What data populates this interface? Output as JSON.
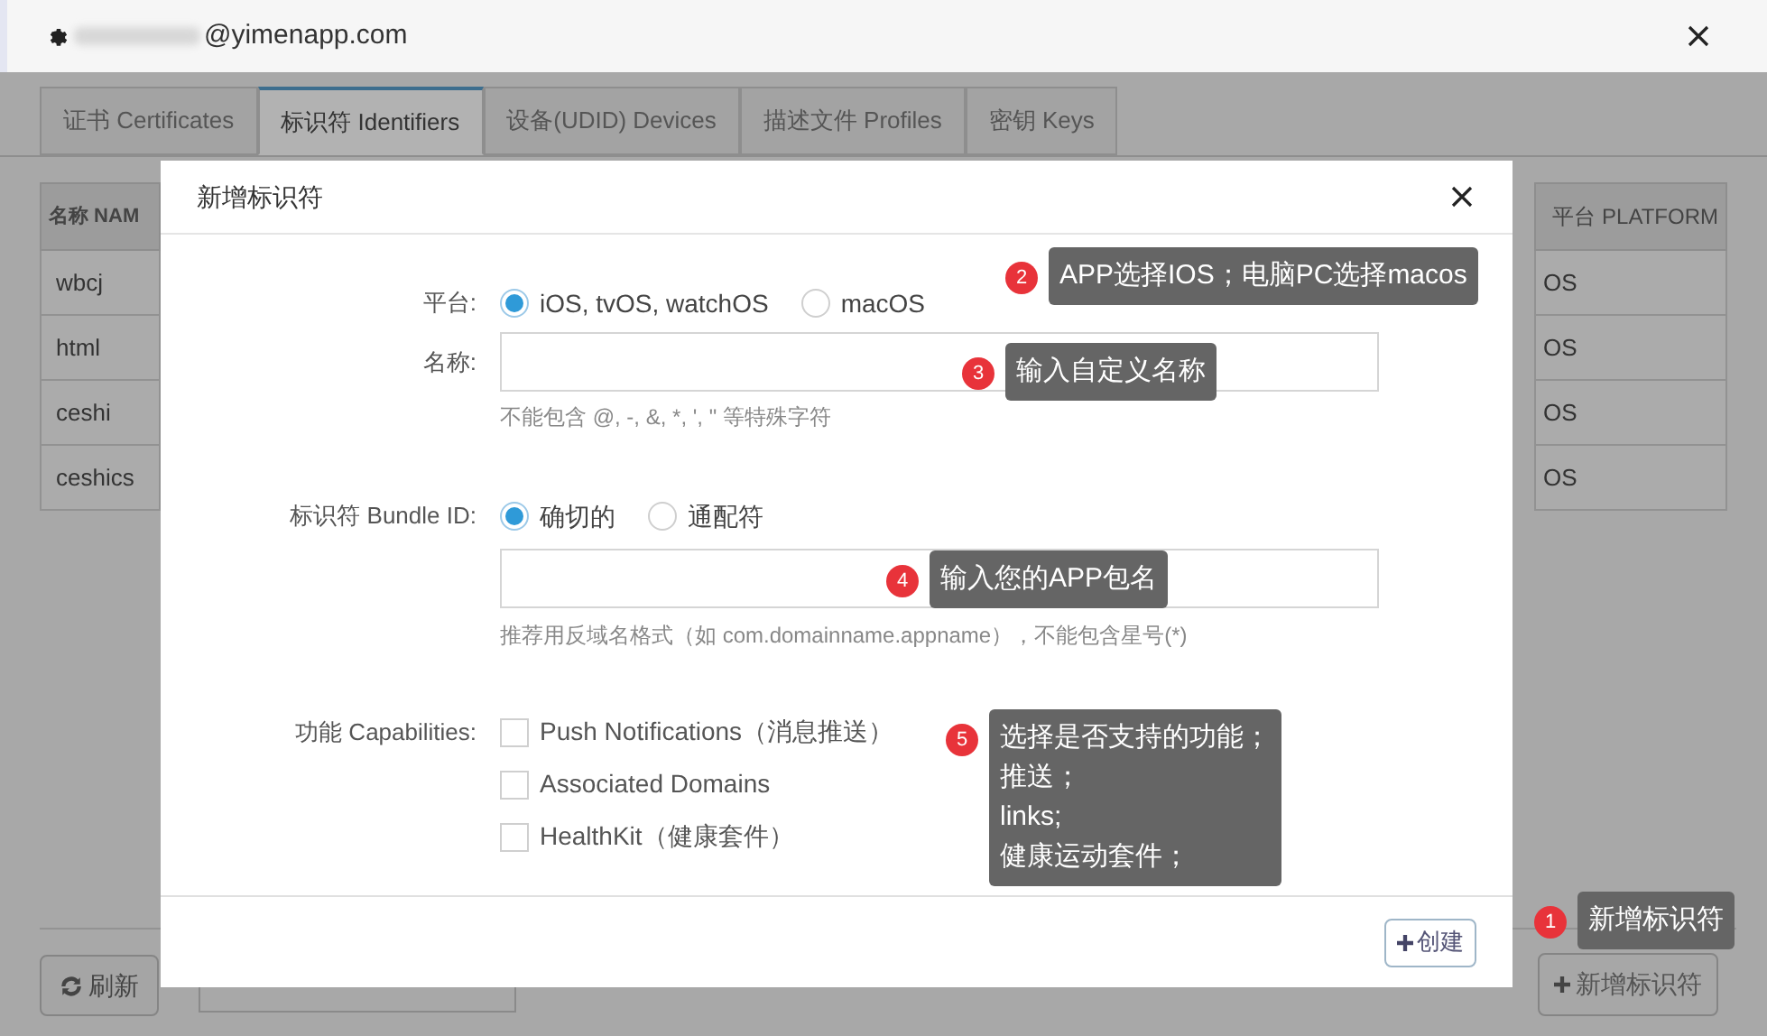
{
  "window": {
    "account": "@yimenapp.com"
  },
  "tabs": [
    {
      "label": "证书 Certificates",
      "selected": false
    },
    {
      "label": "标识符 Identifiers",
      "selected": true
    },
    {
      "label": "设备(UDID) Devices",
      "selected": false
    },
    {
      "label": "描述文件 Profiles",
      "selected": false
    },
    {
      "label": "密钥 Keys",
      "selected": false
    }
  ],
  "table": {
    "columns": [
      "名称 NAM",
      "平台 PLATFORM"
    ],
    "rows": [
      {
        "name": "wbcj",
        "platform": "OS"
      },
      {
        "name": "html",
        "platform": "OS"
      },
      {
        "name": "ceshi",
        "platform": "OS"
      },
      {
        "name": "ceshics",
        "platform": "OS"
      }
    ]
  },
  "toolbar": {
    "refresh_button": "刷新",
    "add_button": "新增标识符"
  },
  "dialog": {
    "title": "新增标识符",
    "platform": {
      "label": "平台:",
      "options": [
        {
          "label": "iOS, tvOS, watchOS",
          "selected": true
        },
        {
          "label": "macOS",
          "selected": false
        }
      ]
    },
    "name": {
      "label": "名称:",
      "hint": "不能包含 @, -, &, *, ', \" 等特殊字符"
    },
    "bundle_id": {
      "label": "标识符 Bundle ID:",
      "options": [
        {
          "label": "确切的",
          "selected": true
        },
        {
          "label": "通配符",
          "selected": false
        }
      ],
      "hint": "推荐用反域名格式（如 com.domainname.appname），不能包含星号(*)"
    },
    "capabilities": {
      "label": "功能 Capabilities:",
      "items": [
        {
          "label": "Push Notifications（消息推送）",
          "checked": false
        },
        {
          "label": "Associated Domains",
          "checked": false
        },
        {
          "label": "HealthKit（健康套件）",
          "checked": false
        }
      ]
    },
    "create_button": "创建"
  },
  "annotations": [
    {
      "number": "1",
      "lines": [
        "新增标识符"
      ]
    },
    {
      "number": "2",
      "lines": [
        "APP选择IOS；电脑PC选择macos"
      ]
    },
    {
      "number": "3",
      "lines": [
        "输入自定义名称"
      ]
    },
    {
      "number": "4",
      "lines": [
        "输入您的APP包名"
      ]
    },
    {
      "number": "5",
      "lines": [
        "选择是否支持的功能；",
        "推送；",
        "links;",
        "健康运动套件；"
      ]
    }
  ]
}
